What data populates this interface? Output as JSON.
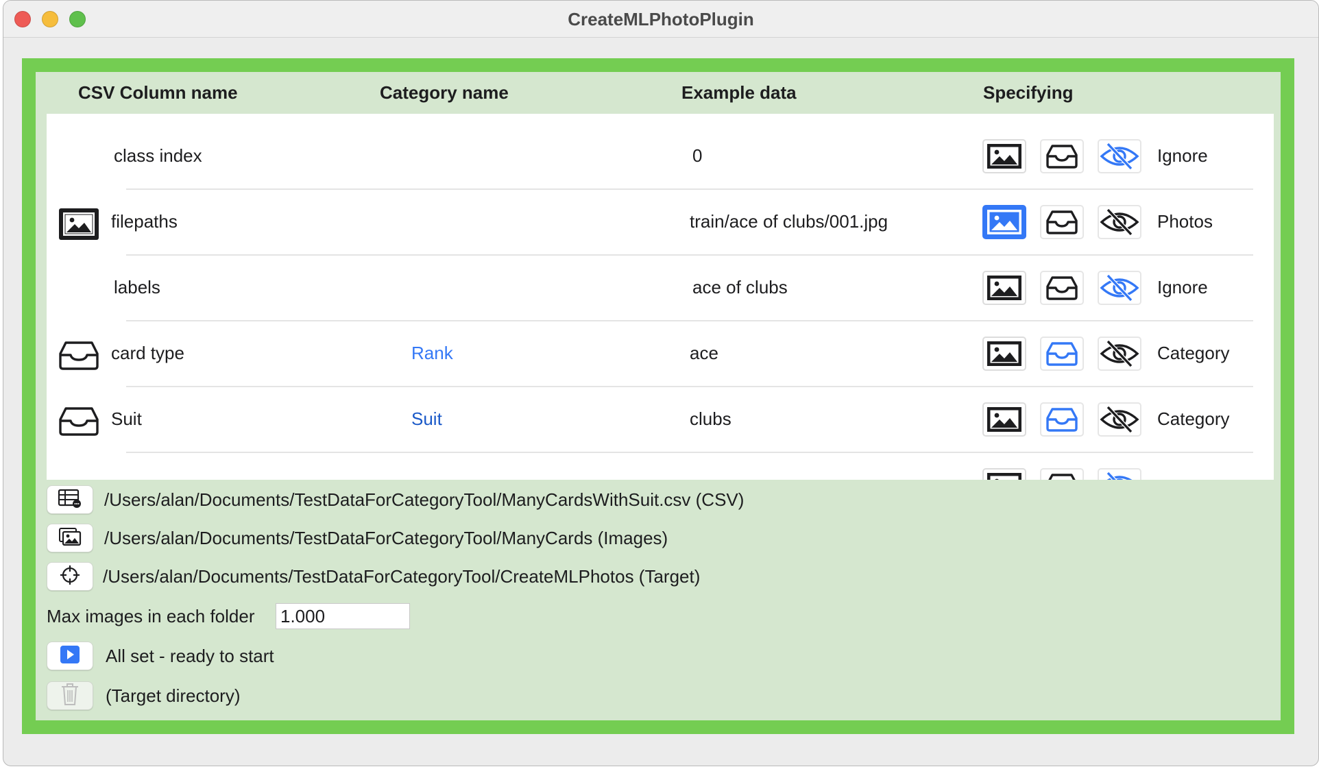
{
  "window": {
    "title": "CreateMLPhotoPlugin"
  },
  "table": {
    "headers": {
      "csv_column": "CSV Column name",
      "category": "Category name",
      "example": "Example data",
      "specifying": "Specifying"
    },
    "rows": [
      {
        "column": "class index",
        "category": "",
        "example": "0",
        "specifying": "Ignore",
        "selected": "ignore",
        "lead_icon": ""
      },
      {
        "column": "filepaths",
        "category": "",
        "example": "train/ace of clubs/001.jpg",
        "specifying": "Photos",
        "selected": "photo",
        "lead_icon": "photo-icon"
      },
      {
        "column": "labels",
        "category": "",
        "example": "ace of clubs",
        "specifying": "Ignore",
        "selected": "ignore",
        "lead_icon": ""
      },
      {
        "column": "card type",
        "category": "Rank",
        "example": "ace",
        "specifying": "Category",
        "selected": "category",
        "lead_icon": "tray-icon"
      },
      {
        "column": "Suit",
        "category": "Suit",
        "example": "clubs",
        "specifying": "Category",
        "selected": "category",
        "lead_icon": "tray-icon"
      }
    ]
  },
  "files": {
    "csv": {
      "path": "/Users/alan/Documents/TestDataForCategoryTool/ManyCardsWithSuit.csv (CSV)",
      "icon": "table-icon"
    },
    "images": {
      "path": "/Users/alan/Documents/TestDataForCategoryTool/ManyCards (Images)",
      "icon": "photos-icon"
    },
    "target": {
      "path": "/Users/alan/Documents/TestDataForCategoryTool/CreateMLPhotos (Target)",
      "icon": "crosshair-icon"
    }
  },
  "settings": {
    "max_images_label": "Max images in each folder",
    "max_images_value": "1.000"
  },
  "actions": {
    "start": {
      "label": "All set - ready to start",
      "icon": "play-icon"
    },
    "delete": {
      "label": "(Target directory)",
      "icon": "trash-icon"
    }
  },
  "colors": {
    "accent_blue": "#3478f6",
    "green_border": "#74cd52",
    "green_panel": "#d5e7cf"
  }
}
